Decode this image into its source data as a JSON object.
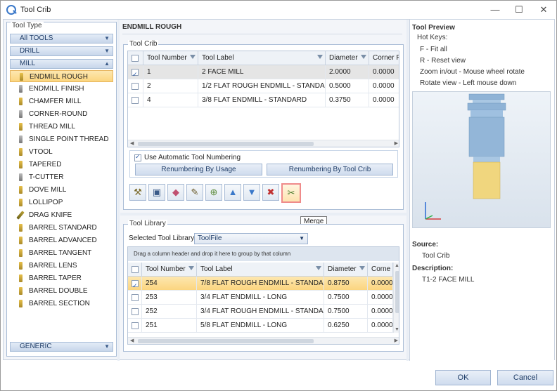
{
  "window": {
    "title": "Tool Crib",
    "minimize": "—",
    "maximize": "☐",
    "close": "✕"
  },
  "tool_type": {
    "caption": "Tool Type",
    "groups": [
      {
        "label": "All TOOLS"
      },
      {
        "label": "DRILL"
      },
      {
        "label": "MILL"
      }
    ],
    "items": [
      {
        "label": "ENDMILL ROUGH"
      },
      {
        "label": "ENDMILL FINISH"
      },
      {
        "label": "CHAMFER MILL"
      },
      {
        "label": "CORNER-ROUND"
      },
      {
        "label": "THREAD MILL"
      },
      {
        "label": "SINGLE POINT THREAD"
      },
      {
        "label": "VTOOL"
      },
      {
        "label": "TAPERED"
      },
      {
        "label": "T-CUTTER"
      },
      {
        "label": "DOVE MILL"
      },
      {
        "label": "LOLLIPOP"
      },
      {
        "label": "DRAG KNIFE"
      },
      {
        "label": "BARREL STANDARD"
      },
      {
        "label": "BARREL ADVANCED"
      },
      {
        "label": "BARREL TANGENT"
      },
      {
        "label": "BARREL LENS"
      },
      {
        "label": "BARREL TAPER"
      },
      {
        "label": "BARREL DOUBLE"
      },
      {
        "label": "BARREL SECTION"
      }
    ],
    "bottom_group": "GENERIC"
  },
  "main": {
    "title": "ENDMILL ROUGH",
    "crib": {
      "caption": "Tool Crib",
      "columns": [
        "Tool Number",
        "Tool Label",
        "Diameter",
        "Corner Ra"
      ],
      "rows": [
        {
          "num": "1",
          "label": "2 FACE MILL",
          "dia": "2.0000",
          "corner": "0.0000"
        },
        {
          "num": "2",
          "label": "1/2 FLAT ROUGH ENDMILL - STANDARD",
          "dia": "0.5000",
          "corner": "0.0000"
        },
        {
          "num": "4",
          "label": "3/8 FLAT ENDMILL - STANDARD",
          "dia": "0.3750",
          "corner": "0.0000"
        }
      ],
      "auto_numbering_label": "Use Automatic Tool Numbering",
      "renumber_usage": "Renumbering By Usage",
      "renumber_crib": "Renumbering By Tool Crib"
    },
    "tooltip": "Merge",
    "library": {
      "caption": "Tool Library",
      "selected_label": "Selected Tool Library",
      "selected_value": "ToolFile",
      "group_hint": "Drag a column header and drop it here to group by that column",
      "columns": [
        "Tool Number",
        "Tool Label",
        "Diameter",
        "Corne"
      ],
      "rows": [
        {
          "num": "254",
          "label": "7/8 FLAT ROUGH ENDMILL - STANDARD",
          "dia": "0.8750",
          "corner": "0.0000"
        },
        {
          "num": "253",
          "label": "3/4 FLAT ENDMILL - LONG",
          "dia": "0.7500",
          "corner": "0.0000"
        },
        {
          "num": "252",
          "label": "3/4 FLAT ROUGH ENDMILL - STANDARD",
          "dia": "0.7500",
          "corner": "0.0000"
        },
        {
          "num": "251",
          "label": "5/8 FLAT ENDMILL - LONG",
          "dia": "0.6250",
          "corner": "0.0000"
        }
      ]
    }
  },
  "preview": {
    "title": "Tool Preview",
    "hotkeys_label": "Hot Keys:",
    "hotkeys": [
      "F - Fit all",
      "R - Reset view",
      "Zoom in/out - Mouse wheel rotate",
      "Rotate view - Left mouse down"
    ],
    "source_label": "Source:",
    "source_value": "Tool Crib",
    "description_label": "Description:",
    "description_value": "T1-2 FACE MILL"
  },
  "footer": {
    "ok": "OK",
    "cancel": "Cancel"
  }
}
